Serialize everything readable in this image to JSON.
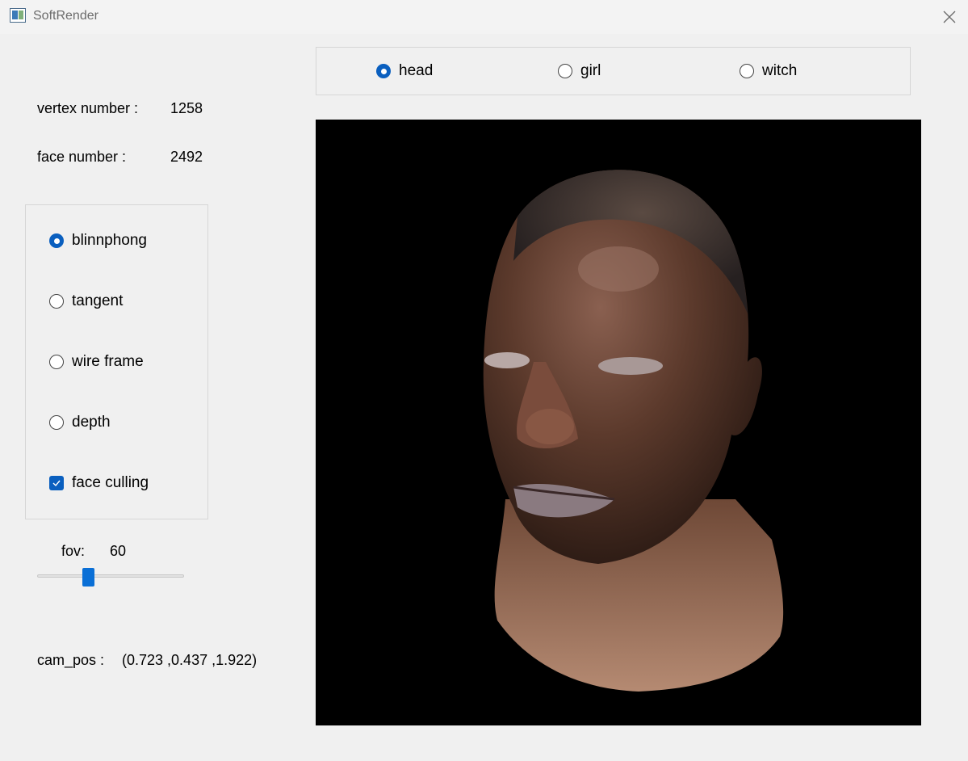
{
  "window": {
    "title": "SoftRender"
  },
  "stats": {
    "vertex_label": "vertex number :",
    "vertex_value": "1258",
    "face_label": "face number :",
    "face_value": "2492"
  },
  "model_select": {
    "options": [
      {
        "label": "head",
        "checked": true
      },
      {
        "label": "girl",
        "checked": false
      },
      {
        "label": "witch",
        "checked": false
      }
    ]
  },
  "render_mode": {
    "options": [
      {
        "label": "blinnphong",
        "checked": true
      },
      {
        "label": "tangent",
        "checked": false
      },
      {
        "label": "wire frame",
        "checked": false
      },
      {
        "label": "depth",
        "checked": false
      }
    ],
    "face_culling": {
      "label": "face culling",
      "checked": true
    }
  },
  "fov": {
    "label": "fov:",
    "value": "60",
    "fraction": 0.33
  },
  "camera": {
    "label": "cam_pos :",
    "value": "(0.723 ,0.437 ,1.922)"
  },
  "colors": {
    "accent": "#0a5fbf",
    "viewport_bg": "#000000",
    "window_bg": "#f0f0f0"
  }
}
